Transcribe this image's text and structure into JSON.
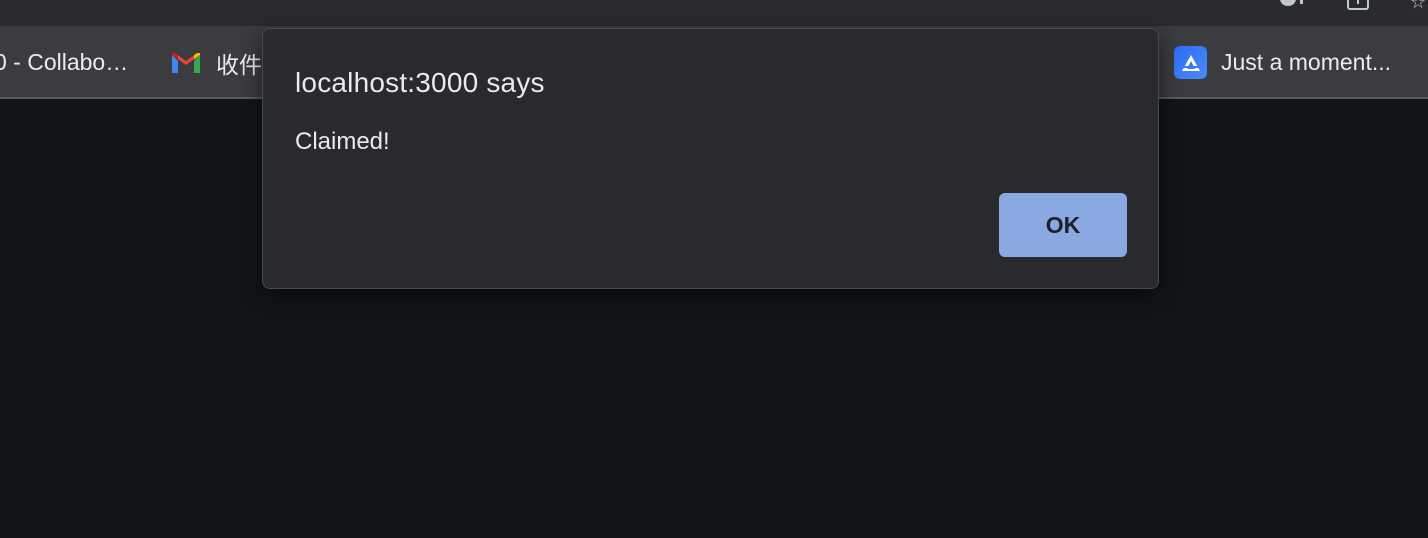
{
  "bookmarks": [
    {
      "label": "0 - Collabo…",
      "icon": "collab-bookmark"
    },
    {
      "label": "收件",
      "icon": "gmail-icon"
    },
    {
      "label": "Just a moment...",
      "icon": "app-triangle-icon"
    }
  ],
  "alert": {
    "title": "localhost:3000 says",
    "message": "Claimed!",
    "ok_label": "OK"
  },
  "colors": {
    "toolbar": "#2a2b2e",
    "bookmarks_bar": "#3b3c3f",
    "page_background": "#111419",
    "dialog_background": "#292a2d",
    "ok_button": "#8aa8e2",
    "text": "#e8eaed"
  }
}
